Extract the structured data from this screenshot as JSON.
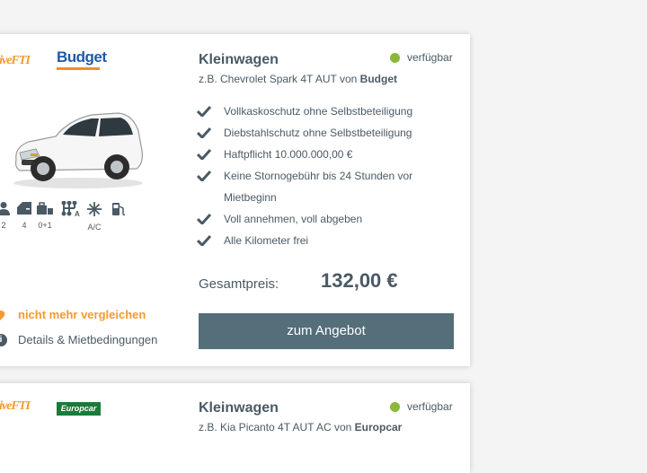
{
  "offers": [
    {
      "broker_logo": "GiveFTI",
      "supplier_logo": "Budget",
      "category": "Kleinwagen",
      "example_prefix": "z.B. Chevrolet Spark 4T AUT von",
      "supplier": "Budget",
      "availability": "verfügbar",
      "features_icons": [
        {
          "icon": "person-icon",
          "label": "2"
        },
        {
          "icon": "door-icon",
          "label": "4"
        },
        {
          "icon": "luggage-icon",
          "label": "0+1"
        },
        {
          "icon": "gearshift-icon",
          "label": ""
        },
        {
          "icon": "snowflake-icon",
          "label": "A/C"
        },
        {
          "icon": "fuel-icon",
          "label": ""
        }
      ],
      "features": [
        "Vollkaskoschutz ohne Selbstbeteiligung",
        "Diebstahlschutz ohne Selbstbeteiligung",
        "Haftpflicht 10.000.000,00 €",
        "Keine Stornogebühr bis 24 Stunden vor Mietbeginn",
        "Voll annehmen, voll abgeben",
        "Alle Kilometer frei"
      ],
      "price_label": "Gesamtpreis:",
      "price": "132,00 €",
      "compare_label": "nicht mehr vergleichen",
      "details_label": "Details & Mietbedingungen",
      "cta_label": "zum Angebot"
    },
    {
      "broker_logo": "GiveFTI",
      "supplier_logo": "Europcar",
      "category": "Kleinwagen",
      "example_prefix": "z.B. Kia Picanto 4T AUT AC von",
      "supplier": "Europcar",
      "availability": "verfügbar"
    }
  ],
  "colors": {
    "accent_orange": "#f39b2a",
    "available_green": "#8ab83a",
    "cta_bg": "#546e7a",
    "text": "#4a5a65"
  }
}
